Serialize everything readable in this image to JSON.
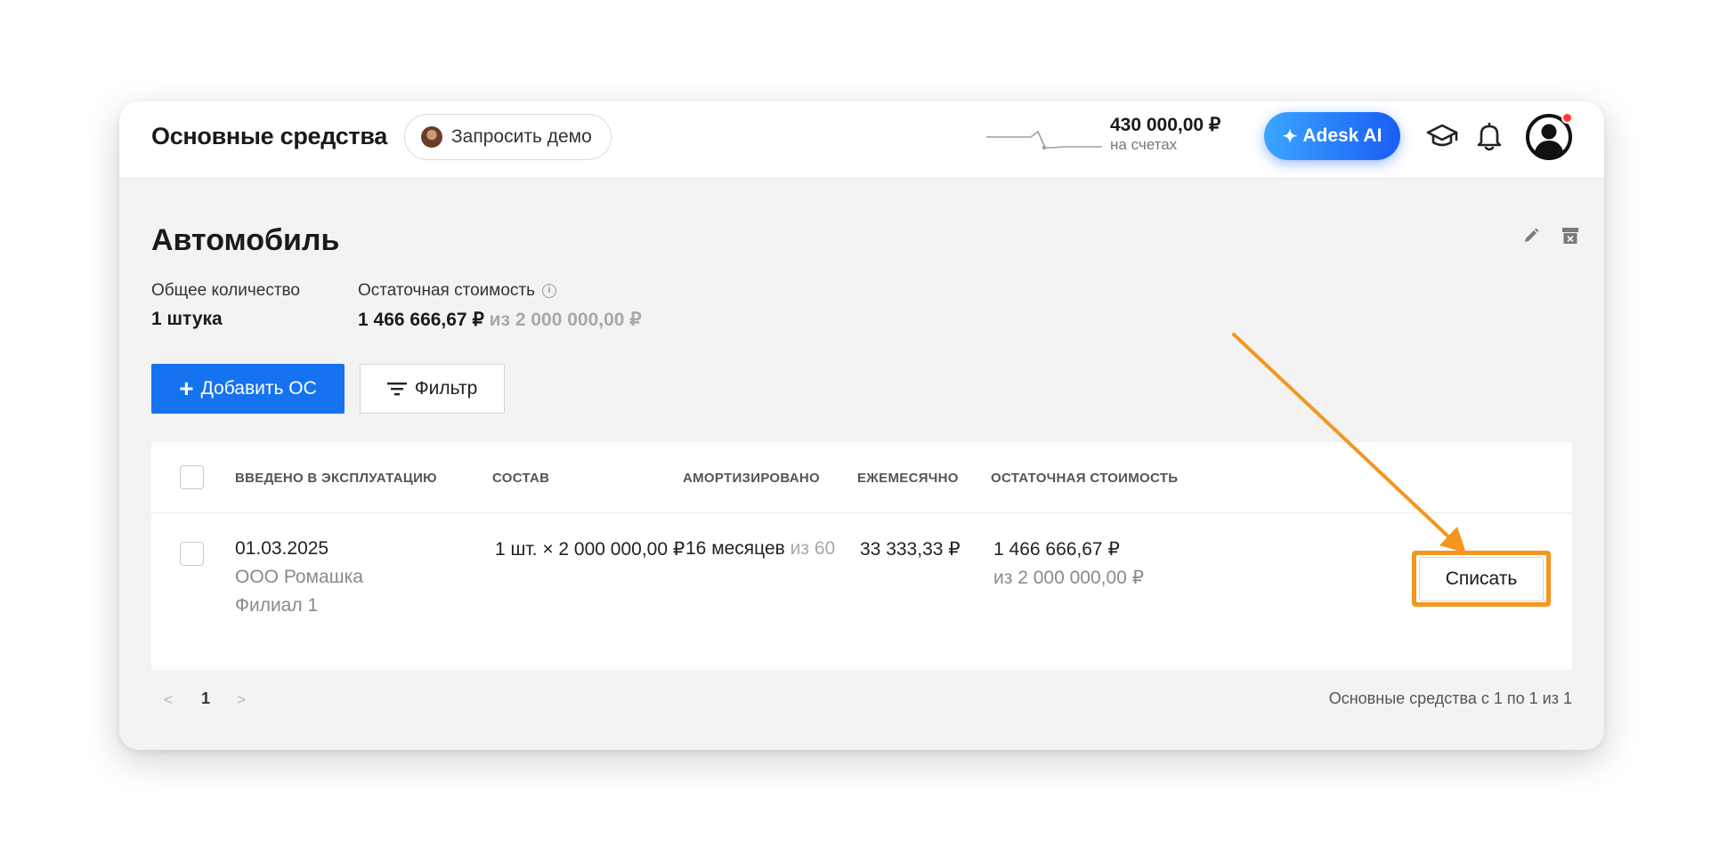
{
  "header": {
    "app_title": "Основные средства",
    "demo_button": "Запросить демо",
    "balance_amount": "430 000,00 ₽",
    "balance_label": "на счетах",
    "ai_button": "Adesk AI"
  },
  "asset": {
    "title": "Автомобиль",
    "qty_label": "Общее количество",
    "qty_value": "1 штука",
    "residual_label": "Остаточная стоимость",
    "residual_value": "1 466 666,67 ₽",
    "residual_of": "из 2 000 000,00 ₽"
  },
  "toolbar": {
    "add_label": "Добавить ОС",
    "filter_label": "Фильтр"
  },
  "table": {
    "columns": [
      "ВВЕДЕНО В ЭКСПЛУАТАЦИЮ",
      "СОСТАВ",
      "АМОРТИЗИРОВАНО",
      "ЕЖЕМЕСЯЧНО",
      "ОСТАТОЧНАЯ СТОИМОСТЬ"
    ],
    "rows": [
      {
        "date": "01.03.2025",
        "company": "ООО Ромашка",
        "branch": "Филиал 1",
        "composition": "1 шт. × 2 000 000,00 ₽",
        "amortized": "16 месяцев",
        "amortized_of": "из 60",
        "monthly": "33 333,33 ₽",
        "residual": "1 466 666,67 ₽",
        "residual_of": "из 2 000 000,00 ₽",
        "action": "Списать"
      }
    ]
  },
  "pagination": {
    "prev": "<",
    "page": "1",
    "next": ">",
    "summary": "Основные средства с 1 по 1 из 1"
  },
  "colors": {
    "primary": "#1673f0",
    "highlight": "#f5961f",
    "notification": "#ff3b2f"
  }
}
